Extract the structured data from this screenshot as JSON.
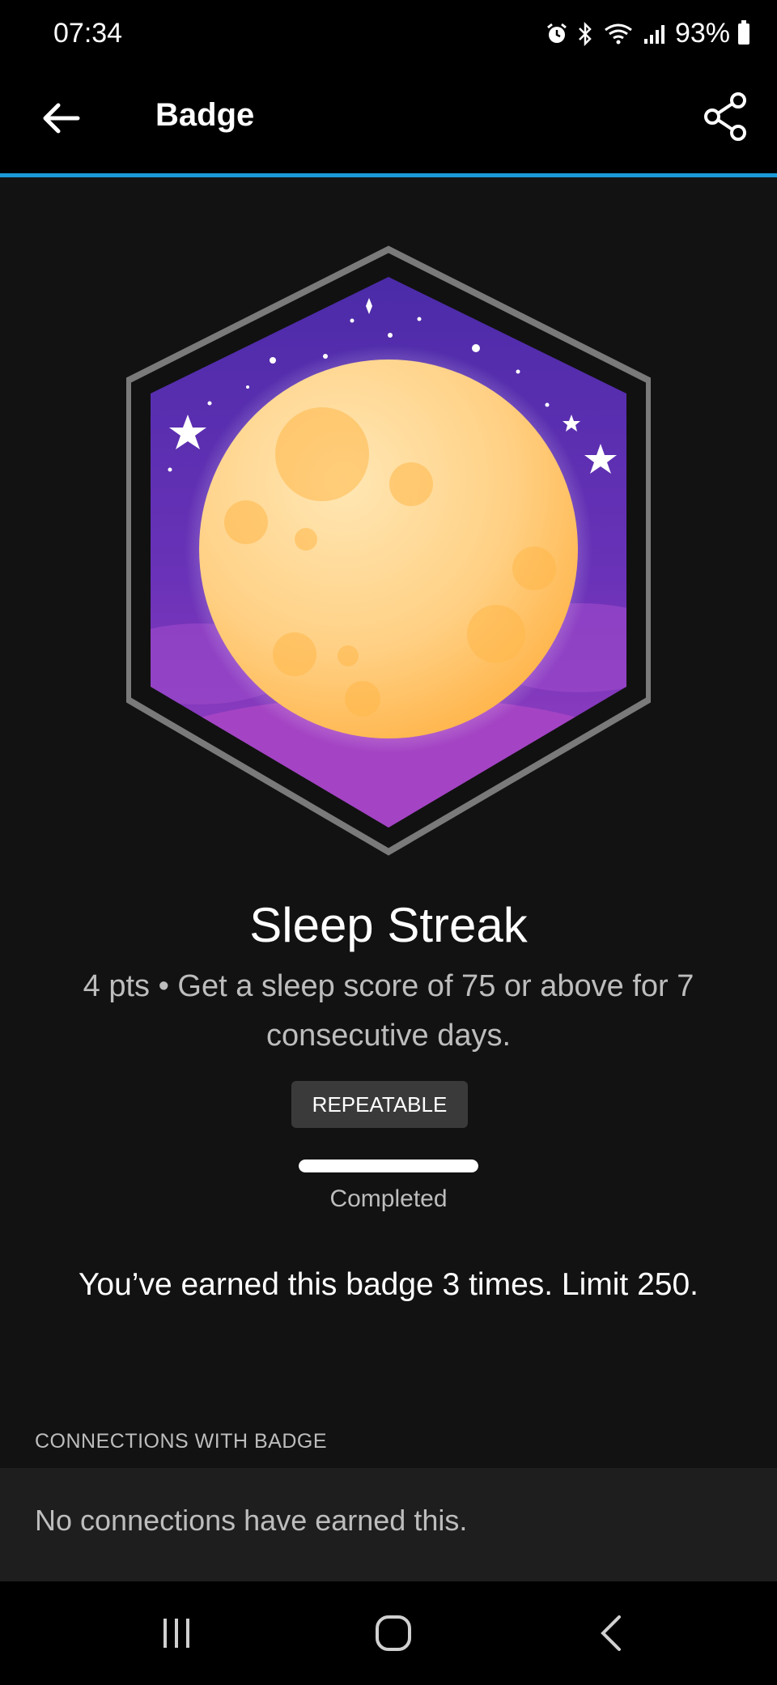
{
  "status_bar": {
    "time": "07:34",
    "battery": "93%",
    "icons": [
      "alarm-icon",
      "bluetooth-icon",
      "wifi-icon",
      "signal-icon",
      "battery-icon"
    ]
  },
  "app_bar": {
    "title": "Badge",
    "back_icon": "arrow-left-icon",
    "share_icon": "share-icon"
  },
  "badge": {
    "name": "Sleep Streak",
    "description": "4 pts • Get a sleep score of 75 or above for 7 consecutive days.",
    "tag": "REPEATABLE",
    "progress_fraction": 1.0,
    "progress_label": "Completed",
    "earned_text": "You’ve earned this badge 3 times. Limit 250."
  },
  "connections": {
    "header": "CONNECTIONS WITH BADGE",
    "empty_text": "No connections have earned this."
  },
  "colors": {
    "accent": "#1b9ad8",
    "background": "#121212",
    "badge_purple_top": "#5a2bb5",
    "badge_purple_bottom": "#9b3fc4",
    "moon": "#ffd07a"
  }
}
